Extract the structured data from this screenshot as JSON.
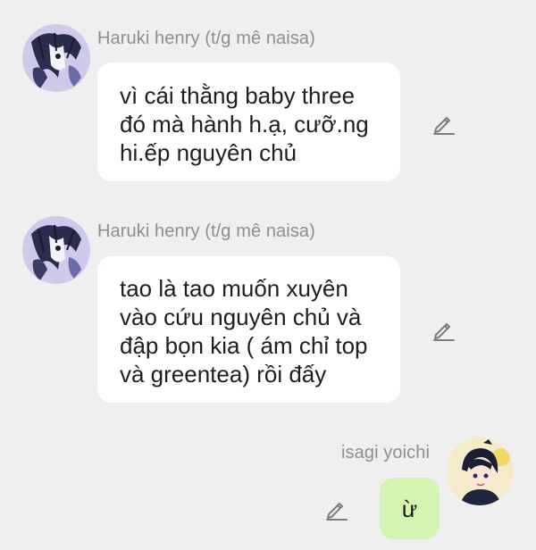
{
  "messages": [
    {
      "sender": "Haruki henry (t/g mê naisa)",
      "lines": [
        "vì cái thằng baby three",
        "đó mà hành h.ạ, cưỡ.ng",
        "hi.ếp nguyên chủ"
      ],
      "edit_icon": "pencil-icon"
    },
    {
      "sender": "Haruki henry (t/g mê naisa)",
      "lines": [
        "tao là tao muốn xuyên",
        "vào cứu nguyên chủ và",
        "đập bọn kia ( ám chỉ top",
        "và greentea) rồi đấy"
      ],
      "edit_icon": "pencil-icon"
    },
    {
      "sender": "isagi yoichi",
      "text": "ừ",
      "edit_icon": "pencil-icon",
      "outgoing": true
    }
  ],
  "colors": {
    "background": "#efefef",
    "incoming_bubble": "#ffffff",
    "outgoing_bubble": "#d5f4b2",
    "sender_name": "#8e8e8e",
    "text": "#1e1e1e"
  }
}
